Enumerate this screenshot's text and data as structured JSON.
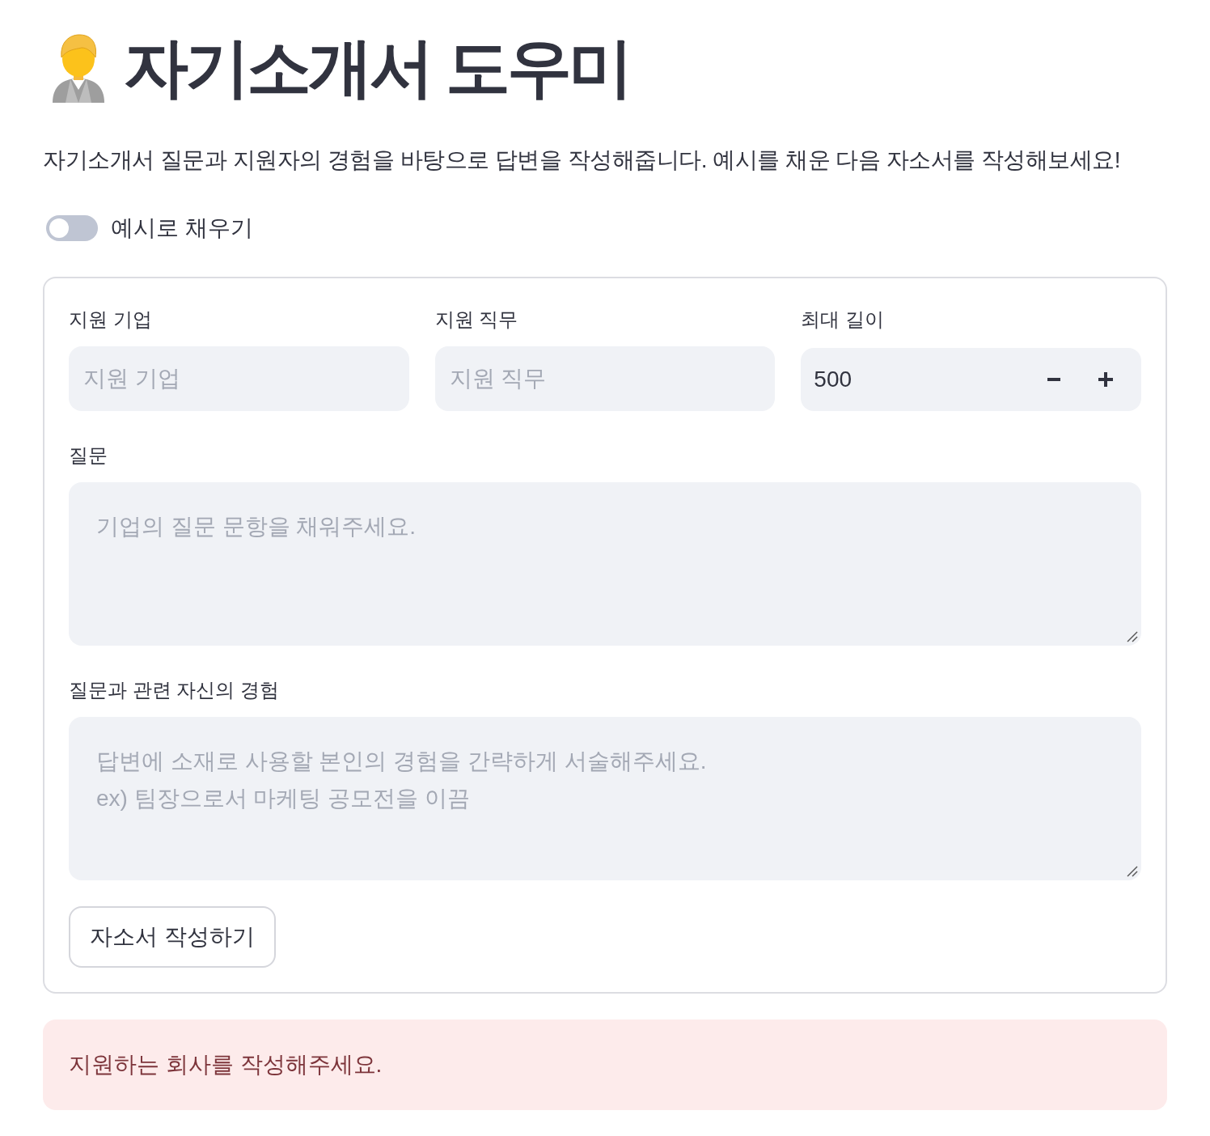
{
  "header": {
    "title": "자기소개서 도우미"
  },
  "description": "자기소개서 질문과 지원자의 경험을 바탕으로 답변을 작성해줍니다. 예시를 채운 다음 자소서를 작성해보세요!",
  "toggle": {
    "label": "예시로 채우기",
    "on": false
  },
  "form": {
    "columns": [
      {
        "kind": "text",
        "label": "지원 기업",
        "placeholder": "지원 기업"
      },
      {
        "kind": "text",
        "label": "지원 직무",
        "placeholder": "지원 직무"
      },
      {
        "kind": "number",
        "label": "최대 길이",
        "value": "500"
      }
    ],
    "text_areas": [
      {
        "label": "질문",
        "placeholder": "기업의 질문 문항을 채워주세요."
      },
      {
        "label": "질문과 관련 자신의 경험",
        "placeholder": "답변에 소재로 사용할 본인의 경험을 간략하게 서술해주세요.\nex) 팀장으로서 마케팅 공모전을 이끔"
      }
    ],
    "submit_button": "자소서 작성하기"
  },
  "alert": {
    "kind": "error",
    "text": "지원하는 회사를 작성해주세요."
  }
}
